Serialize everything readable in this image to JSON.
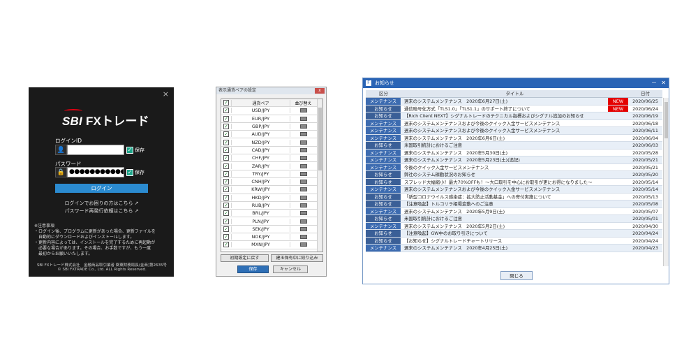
{
  "login": {
    "close": "×",
    "logo_sbi": "SBI",
    "logo_name": "FXトレード",
    "id_label": "ログインID",
    "id_value": "",
    "password_label": "パスワード",
    "password_value": "●●●●●●●●●●●●",
    "save_label": "保存",
    "login_button": "ログイン",
    "link_trouble": "ログインでお困りの方はこちら ↗",
    "link_reissue": "パスワード再発行依頼はこちら ↗",
    "notes": [
      "※注意事項",
      "・ログイン後、プログラムに更新があった場合、更新ファイルを",
      "　自動的にダウンロードおよびインストールします。",
      "・更新内容によっては、インストールを完了するために再起動が",
      "　必要な場合があります。その場合、お手数ですが、もう一度",
      "　最初からお願いいたします。"
    ],
    "footer_company": "SBI FXトレード株式会社　金融商品取引業者 関東財務局長(金商)第2635号",
    "footer_copyright": "© SBI FXTRADE Co., Ltd. ALL Rights Reserved."
  },
  "pairs": {
    "title": "表示通貨ペアの設定",
    "close": "x",
    "header_pair": "通貨ペア",
    "header_sort": "並び替え",
    "items": [
      "USD/JPY",
      "EUR/JPY",
      "GBP/JPY",
      "AUD/JPY",
      "NZD/JPY",
      "CAD/JPY",
      "CHF/JPY",
      "ZAR/JPY",
      "TRY/JPY",
      "CNH/JPY",
      "KRW/JPY",
      "HKD/JPY",
      "RUB/JPY",
      "BRL/JPY",
      "PLN/JPY",
      "SEK/JPY",
      "NOK/JPY",
      "MXN/JPY"
    ],
    "btn_reset": "初期設定に戻す",
    "btn_filter": "建玉保有中に絞り込み",
    "btn_save": "保存",
    "btn_cancel": "キャンセル"
  },
  "notice": {
    "title": "お知らせ",
    "app_icon": "F",
    "minimize": "－",
    "close": "✕",
    "header_category": "区分",
    "header_title": "タイトル",
    "header_date": "日付",
    "maintenance_color": "#3c6bb0",
    "info_color": "#3a5f97",
    "new_color": "#e40000",
    "rows": [
      {
        "category": "メンテナンス",
        "title": "週末のシステムメンテナンス　2020年6月27日(土)",
        "new": "NEW",
        "date": "2020/06/25"
      },
      {
        "category": "お知らせ",
        "title": "通信暗号化方式「TLS1.0」「TLS1.1」のサポート終了について",
        "new": "NEW",
        "date": "2020/06/24"
      },
      {
        "category": "お知らせ",
        "title": "【Rich Client NEXT】シグナルトレードのテクニカル指標およびシグナル追加のお知らせ",
        "new": "",
        "date": "2020/06/19"
      },
      {
        "category": "メンテナンス",
        "title": "週末のシステムメンテナンスおよび今後のクイック入金サービスメンテナンス",
        "new": "",
        "date": "2020/06/18"
      },
      {
        "category": "メンテナンス",
        "title": "週末のシステムメンテナンスおよび今後のクイック入金サービスメンテナンス",
        "new": "",
        "date": "2020/06/11"
      },
      {
        "category": "メンテナンス",
        "title": "週末のシステムメンテナンス　2020年6月6日(土)",
        "new": "",
        "date": "2020/06/04"
      },
      {
        "category": "お知らせ",
        "title": "米国取引統計におけるご注意",
        "new": "",
        "date": "2020/06/03"
      },
      {
        "category": "メンテナンス",
        "title": "週末のシステムメンテナンス　2020年5月30日(土)",
        "new": "",
        "date": "2020/05/28"
      },
      {
        "category": "メンテナンス",
        "title": "週末のシステムメンテナンス　2020年5月23日(土)(追記)",
        "new": "",
        "date": "2020/05/21"
      },
      {
        "category": "メンテナンス",
        "title": "今後のクイック入金サービスメンテナンス",
        "new": "",
        "date": "2020/05/21"
      },
      {
        "category": "お知らせ",
        "title": "弊社のシステム稼動状況のお知らせ",
        "new": "",
        "date": "2020/05/20"
      },
      {
        "category": "お知らせ",
        "title": "スプレッド大幅縮小！最大70%OFFも！～大口取引を中心にお取引が更にお得になりました～",
        "new": "",
        "date": "2020/05/14"
      },
      {
        "category": "メンテナンス",
        "title": "週末のシステムメンテナンスおよび今後のクイック入金サービスメンテナンス",
        "new": "",
        "date": "2020/05/14"
      },
      {
        "category": "お知らせ",
        "title": "「新型コロナウイルス感染症：拡大防止活動基金」への寄付実施について",
        "new": "",
        "date": "2020/05/13"
      },
      {
        "category": "お知らせ",
        "title": "【注意喚起】トルコリラ相場変動へのご注意",
        "new": "",
        "date": "2020/05/08"
      },
      {
        "category": "メンテナンス",
        "title": "週末のシステムメンテナンス　2020年5月9日(土)",
        "new": "",
        "date": "2020/05/07"
      },
      {
        "category": "お知らせ",
        "title": "米国取引統計におけるご注意",
        "new": "",
        "date": "2020/05/01"
      },
      {
        "category": "メンテナンス",
        "title": "週末のシステムメンテナンス　2020年5月2日(土)",
        "new": "",
        "date": "2020/04/30"
      },
      {
        "category": "お知らせ",
        "title": "【注意喚起】GW中のお取り引きについて",
        "new": "",
        "date": "2020/04/24"
      },
      {
        "category": "お知らせ",
        "title": "【お知らせ】シグナルトレードチャートリリース",
        "new": "",
        "date": "2020/04/24"
      },
      {
        "category": "メンテナンス",
        "title": "週末のシステムメンテナンス　2020年4月25日(土)",
        "new": "",
        "date": "2020/04/23"
      }
    ],
    "close_button": "閉じる"
  }
}
